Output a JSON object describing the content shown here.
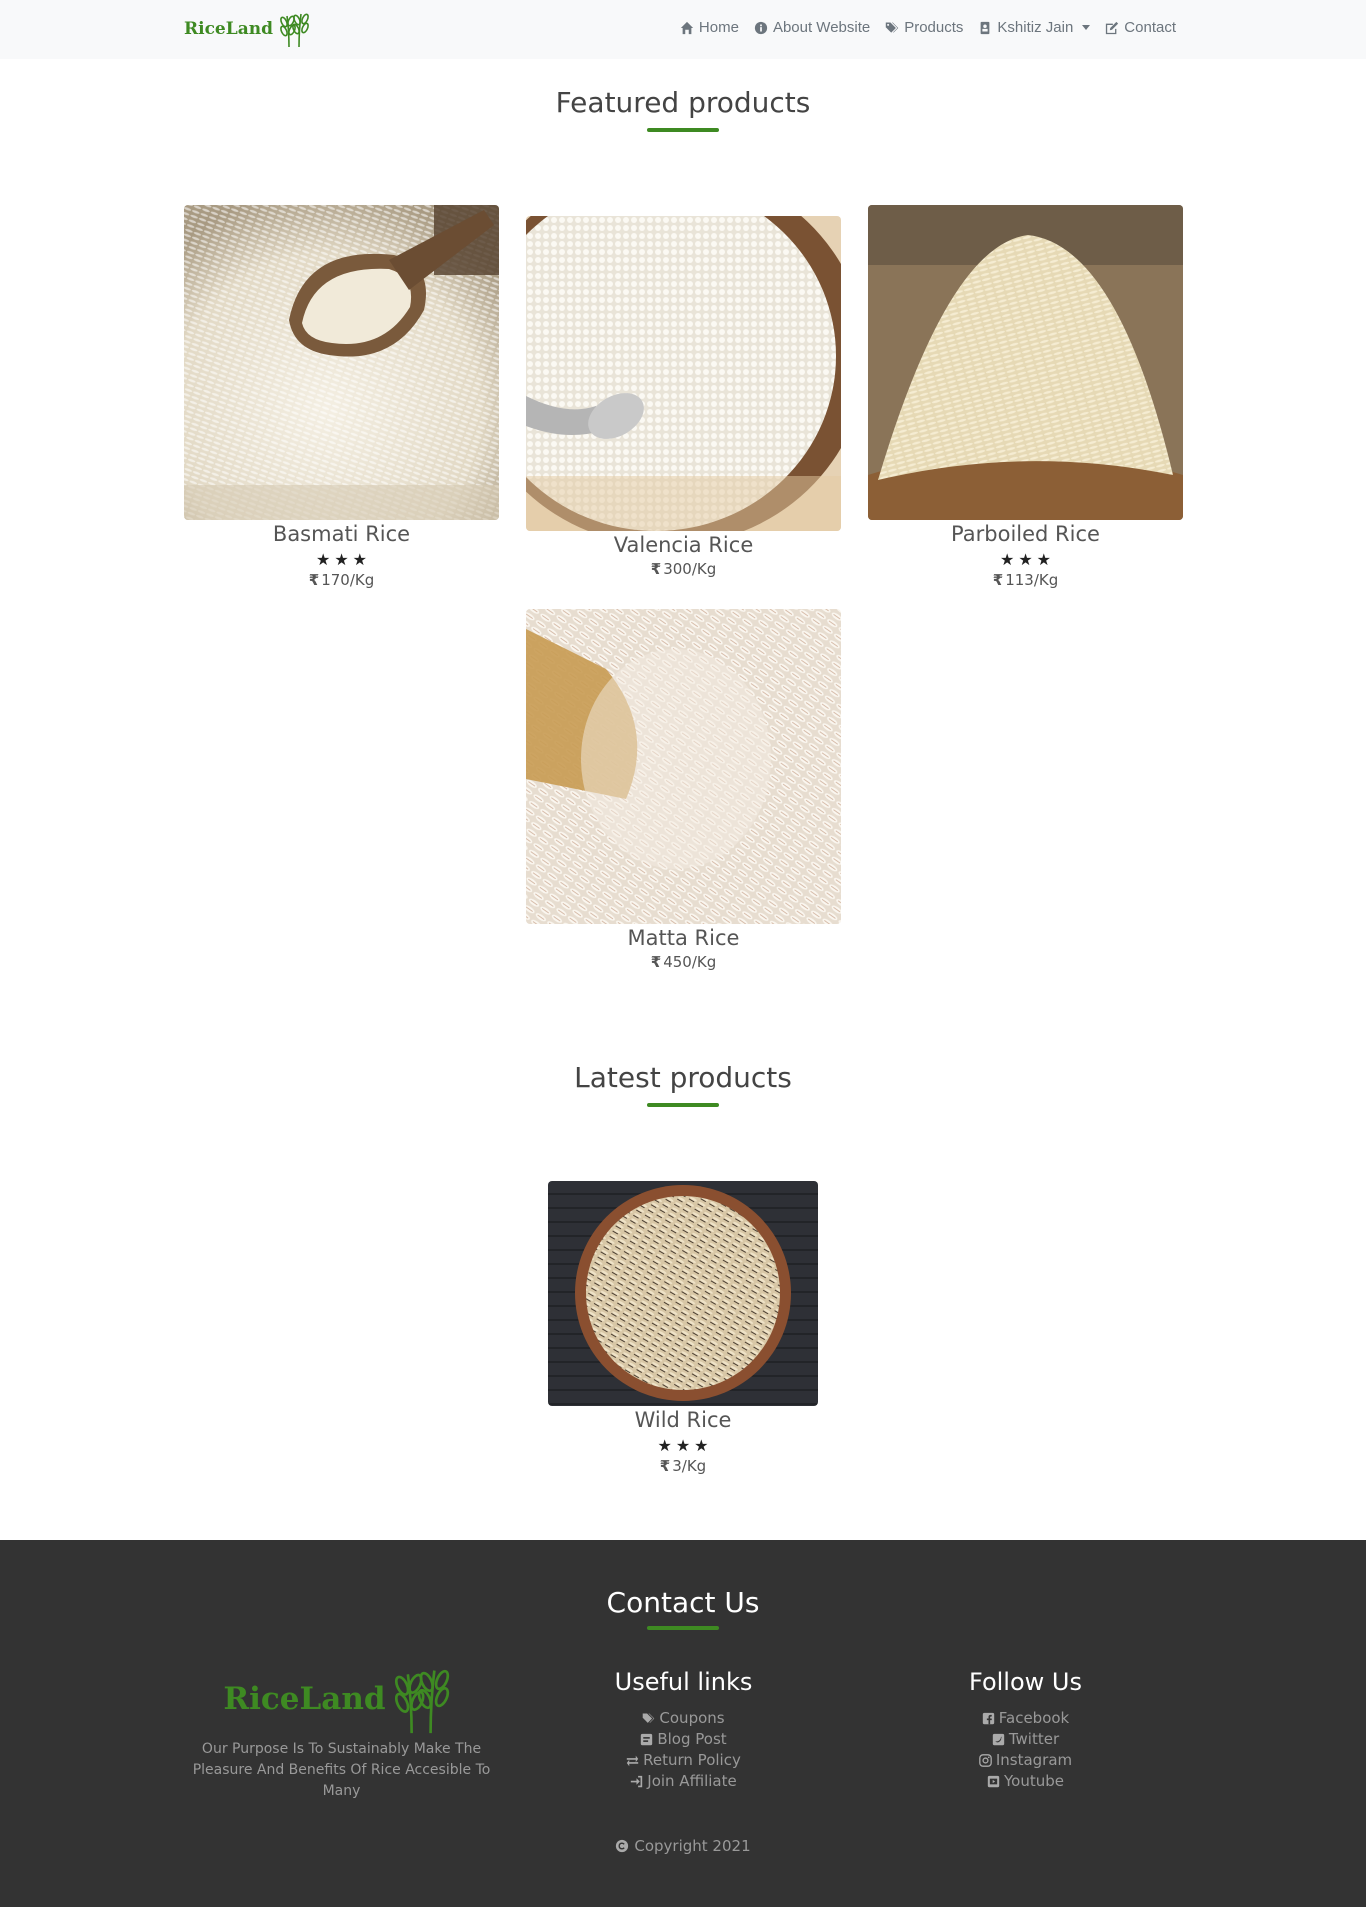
{
  "brand": {
    "name": "RiceLand"
  },
  "nav": {
    "home": "Home",
    "about": "About Website",
    "products": "Products",
    "user": "Kshitiz Jain",
    "contact": "Contact"
  },
  "featured": {
    "title": "Featured products",
    "products": [
      {
        "name": "Basmati Rice",
        "stars": 3,
        "price": "170/Kg"
      },
      {
        "name": "Valencia Rice",
        "price": "300/Kg"
      },
      {
        "name": "Parboiled Rice",
        "stars": 3,
        "price": "113/Kg"
      },
      {
        "name": "Matta Rice",
        "price": "450/Kg"
      }
    ]
  },
  "latest": {
    "title": "Latest products",
    "products": [
      {
        "name": "Wild Rice",
        "stars": 3,
        "price": "3/Kg"
      }
    ]
  },
  "footer": {
    "title": "Contact Us",
    "brand": "RiceLand",
    "description": "Our Purpose Is To Sustainably Make The Pleasure And Benefits Of Rice Accesible To Many",
    "useful_links": {
      "title": "Useful links",
      "items": [
        "Coupons",
        "Blog Post",
        "Return Policy",
        "Join Affiliate"
      ]
    },
    "follow_us": {
      "title": "Follow Us",
      "items": [
        "Facebook",
        "Twitter",
        "Instagram",
        "Youtube"
      ]
    },
    "copyright": "Copyright 2021"
  },
  "colors": {
    "accent": "#3e8a22",
    "footer_bg": "#333333",
    "nav_bg": "#f8f9fa"
  },
  "currency_symbol": "₹"
}
